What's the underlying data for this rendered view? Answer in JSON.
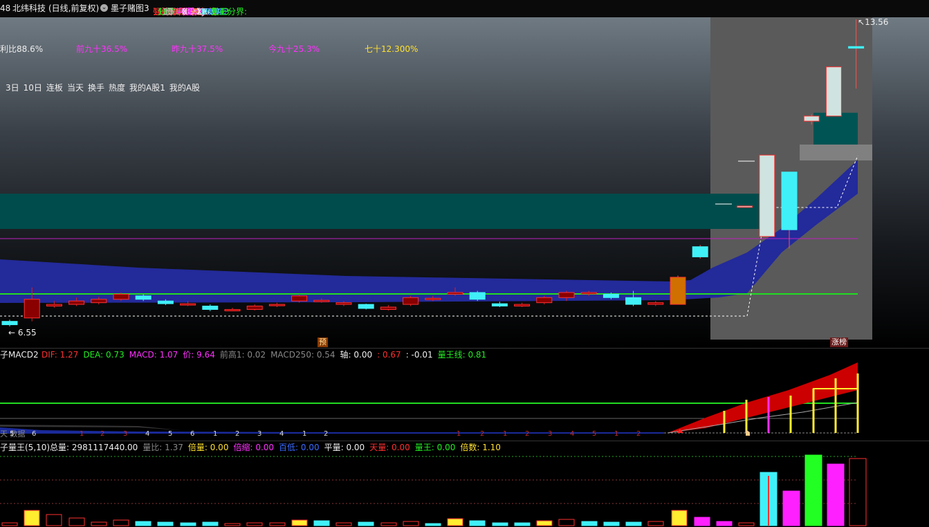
{
  "header": {
    "code_prefix": "48",
    "stock": "北纬科技",
    "period": "(日线,前复权)",
    "indicator_name": "墨子赌图3",
    "items": [
      {
        "label": "强弱分界:",
        "value": "10.05",
        "color": "#ff3030"
      },
      {
        "label": "分界:",
        "value": "10.76",
        "color": "#22ee22"
      },
      {
        "label": "上:",
        "value": "10.75",
        "color": "#bbbbbb"
      },
      {
        "label": "下:",
        "value": "10.41",
        "color": "#bbbbbb"
      },
      {
        "label": "流通市值:",
        "value": "57.69",
        "color": "#ff3030"
      },
      {
        "label": "利润%:",
        "value": "-448.75",
        "color": "#ff30ff"
      },
      {
        "label": "XG9:",
        "value": "0.00",
        "color": "#eeeeee"
      },
      {
        "label": "前高:",
        "value": "8.66",
        "color": "#ff30ff"
      },
      {
        "label": "杀入线:",
        "value": "-",
        "color": "#ff8c00"
      },
      {
        "label": "XJ6:",
        "value": "11.37",
        "color": "#eeeeee"
      },
      {
        "label": "LWT1:",
        "value": "1.00",
        "color": "#40ffff"
      },
      {
        "label": "LWT2:",
        "value": "0.00",
        "color": "#3a6bff"
      },
      {
        "label": "量王分界:",
        "value": "7.43",
        "color": "#22ee22"
      }
    ]
  },
  "main_chart": {
    "stats": [
      {
        "text": "利比88.6%",
        "color": "#eeeeee"
      },
      {
        "text": "前九十36.5%",
        "color": "#ff30ff"
      },
      {
        "text": "昨九十37.5%",
        "color": "#ff30ff"
      },
      {
        "text": "今九十25.3%",
        "color": "#ff30ff"
      },
      {
        "text": "七十12.300%",
        "color": "#ffe030"
      }
    ],
    "tags": [
      "3日",
      "10日",
      "连板",
      "当天",
      "换手",
      "热度",
      "我的A股1",
      "我的A股"
    ],
    "low_label": "6.55",
    "high_label": "13.56",
    "marker_pre": "预",
    "marker_limit": "涨榜",
    "candles": [
      {
        "o": 6.7,
        "c": 6.6,
        "h": 6.75,
        "l": 6.55
      },
      {
        "o": 6.8,
        "c": 7.35,
        "h": 7.7,
        "l": 6.7
      },
      {
        "o": 7.15,
        "c": 7.2,
        "h": 7.3,
        "l": 7.1
      },
      {
        "o": 7.2,
        "c": 7.3,
        "h": 7.4,
        "l": 7.15
      },
      {
        "o": 7.25,
        "c": 7.35,
        "h": 7.42,
        "l": 7.2
      },
      {
        "o": 7.35,
        "c": 7.5,
        "h": 7.55,
        "l": 7.3
      },
      {
        "o": 7.45,
        "c": 7.35,
        "h": 7.5,
        "l": 7.3
      },
      {
        "o": 7.3,
        "c": 7.22,
        "h": 7.35,
        "l": 7.18
      },
      {
        "o": 7.2,
        "c": 7.22,
        "h": 7.3,
        "l": 7.15
      },
      {
        "o": 7.15,
        "c": 7.05,
        "h": 7.2,
        "l": 7.0
      },
      {
        "o": 7.03,
        "c": 7.05,
        "h": 7.1,
        "l": 7.0
      },
      {
        "o": 7.05,
        "c": 7.15,
        "h": 7.2,
        "l": 7.02
      },
      {
        "o": 7.18,
        "c": 7.2,
        "h": 7.25,
        "l": 7.12
      },
      {
        "o": 7.3,
        "c": 7.45,
        "h": 7.5,
        "l": 7.25
      },
      {
        "o": 7.3,
        "c": 7.32,
        "h": 7.38,
        "l": 7.25
      },
      {
        "o": 7.2,
        "c": 7.25,
        "h": 7.3,
        "l": 7.15
      },
      {
        "o": 7.2,
        "c": 7.08,
        "h": 7.22,
        "l": 7.05
      },
      {
        "o": 7.05,
        "c": 7.12,
        "h": 7.18,
        "l": 7.02
      },
      {
        "o": 7.2,
        "c": 7.4,
        "h": 7.45,
        "l": 7.15
      },
      {
        "o": 7.35,
        "c": 7.38,
        "h": 7.45,
        "l": 7.3
      },
      {
        "o": 7.5,
        "c": 7.55,
        "h": 7.7,
        "l": 7.45
      },
      {
        "o": 7.55,
        "c": 7.35,
        "h": 7.6,
        "l": 7.3
      },
      {
        "o": 7.22,
        "c": 7.15,
        "h": 7.28,
        "l": 7.12
      },
      {
        "o": 7.15,
        "c": 7.2,
        "h": 7.25,
        "l": 7.12
      },
      {
        "o": 7.25,
        "c": 7.4,
        "h": 7.45,
        "l": 7.2
      },
      {
        "o": 7.4,
        "c": 7.55,
        "h": 7.6,
        "l": 7.3
      },
      {
        "o": 7.55,
        "c": 7.55,
        "h": 7.6,
        "l": 7.45
      },
      {
        "o": 7.5,
        "c": 7.4,
        "h": 7.55,
        "l": 7.35
      },
      {
        "o": 7.4,
        "c": 7.2,
        "h": 7.6,
        "l": 7.15
      },
      {
        "o": 7.2,
        "c": 7.25,
        "h": 7.3,
        "l": 7.15
      },
      {
        "o": 7.2,
        "c": 8.0,
        "h": 8.05,
        "l": 7.2
      },
      {
        "o": 8.9,
        "c": 8.6,
        "h": 8.95,
        "l": 8.55
      },
      {
        "o": null,
        "c": null,
        "h": null,
        "l": null
      },
      {
        "o": 10.1,
        "c": 10.1,
        "h": 10.1,
        "l": 10.1
      },
      {
        "o": 9.2,
        "c": 11.6,
        "h": 11.6,
        "l": 9.2
      },
      {
        "o": 11.1,
        "c": 9.4,
        "h": 11.1,
        "l": 8.85
      },
      {
        "o": 12.6,
        "c": 12.75,
        "h": 12.8,
        "l": 12.5
      },
      {
        "o": 12.75,
        "c": 14.2,
        "h": 14.2,
        "l": 12.75
      },
      {
        "o": 14.8,
        "c": 14.75,
        "h": 15.6,
        "l": 13.56
      }
    ]
  },
  "macd_panel": {
    "title": "子MACD2",
    "items": [
      {
        "label": "DIF:",
        "value": "1.27",
        "color": "#ff3030"
      },
      {
        "label": "DEA:",
        "value": "0.73",
        "color": "#22ee22"
      },
      {
        "label": "MACD:",
        "value": "1.07",
        "color": "#ff30ff"
      },
      {
        "label": "价:",
        "value": "9.64",
        "color": "#ff30ff"
      },
      {
        "label": "前高1:",
        "value": "0.02",
        "color": "#888888"
      },
      {
        "label": "MACD250:",
        "value": "0.54",
        "color": "#888888"
      },
      {
        "label": "轴:",
        "value": "0.00",
        "color": "#eeeeee"
      },
      {
        "label": ":",
        "value": "0.67",
        "color": "#ff3030"
      },
      {
        "label": ":",
        "value": "-0.01",
        "color": "#eeeeee"
      },
      {
        "label": "量王线:",
        "value": "0.81",
        "color": "#22ee22"
      }
    ],
    "counts": [
      "5",
      "6",
      "1",
      "2",
      "3",
      "4",
      "5",
      "6",
      "1",
      "2",
      "3",
      "4",
      "1",
      "2",
      "1",
      "2",
      "1",
      "2",
      "3",
      "4",
      "5",
      "1",
      "2"
    ],
    "watermark": "天 数据"
  },
  "volume_panel": {
    "title": "子量王(5,10)",
    "items": [
      {
        "label": "总量:",
        "value": "2981117440.00",
        "color": "#eeeeee"
      },
      {
        "label": "量比:",
        "value": "1.37",
        "color": "#888888"
      },
      {
        "label": "倍量:",
        "value": "0.00",
        "color": "#ffe030"
      },
      {
        "label": "倍缩:",
        "value": "0.00",
        "color": "#ff30ff"
      },
      {
        "label": "百低:",
        "value": "0.00",
        "color": "#3a6bff"
      },
      {
        "label": "平量:",
        "value": "0.00",
        "color": "#eeeeee"
      },
      {
        "label": "天量:",
        "value": "0.00",
        "color": "#ff3030"
      },
      {
        "label": "量王:",
        "value": "0.00",
        "color": "#22ee22"
      },
      {
        "label": "倍数:",
        "value": "1.10",
        "color": "#ffe030"
      }
    ]
  }
}
